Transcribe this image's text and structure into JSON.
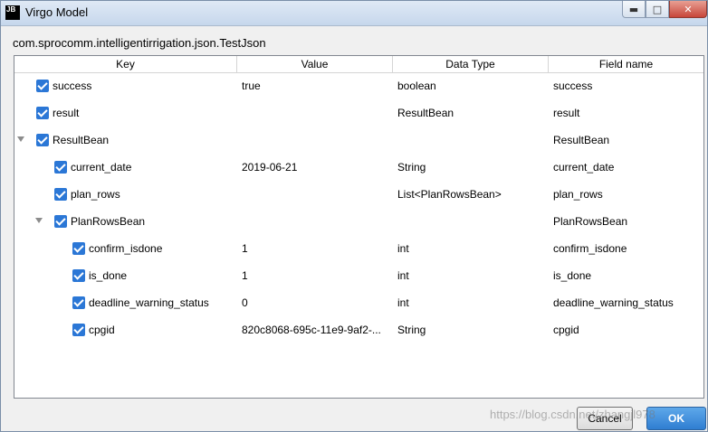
{
  "window": {
    "title": "Virgo Model",
    "icon_text_top": "JB",
    "controls": {
      "minimize_icon": "minimize-icon",
      "maximize_icon": "maximize-icon",
      "close_icon": "close-icon"
    }
  },
  "class_name": "com.sprocomm.intelligentirrigation.json.TestJson",
  "table": {
    "columns": [
      "Key",
      "Value",
      "Data Type",
      "Field name"
    ],
    "rows": [
      {
        "key": "success",
        "value": "true",
        "type": "boolean",
        "field": "success",
        "checked": true,
        "expandable": false
      },
      {
        "key": "result",
        "value": "",
        "type": "ResultBean",
        "field": "result",
        "checked": true,
        "expandable": false
      },
      {
        "key": "ResultBean",
        "value": "",
        "type": "",
        "field": "ResultBean",
        "checked": true,
        "expandable": true
      },
      {
        "key": "current_date",
        "value": "2019-06-21",
        "type": "String",
        "field": "current_date",
        "checked": true,
        "expandable": false
      },
      {
        "key": "plan_rows",
        "value": "",
        "type": "List<PlanRowsBean>",
        "field": "plan_rows",
        "checked": true,
        "expandable": false
      },
      {
        "key": "PlanRowsBean",
        "value": "",
        "type": "",
        "field": "PlanRowsBean",
        "checked": true,
        "expandable": true
      },
      {
        "key": "confirm_isdone",
        "value": "1",
        "type": "int",
        "field": "confirm_isdone",
        "checked": true,
        "expandable": false
      },
      {
        "key": "is_done",
        "value": "1",
        "type": "int",
        "field": "is_done",
        "checked": true,
        "expandable": false
      },
      {
        "key": "deadline_warning_status",
        "value": "0",
        "type": "int",
        "field": "deadline_warning_status",
        "checked": true,
        "expandable": false
      },
      {
        "key": "cpgid",
        "value": "820c8068-695c-11e9-9af2-...",
        "type": "String",
        "field": "cpgid",
        "checked": true,
        "expandable": false
      }
    ]
  },
  "buttons": {
    "cancel": "Cancel",
    "ok": "OK"
  },
  "watermark": "https://blog.csdn.net/zhangjl978",
  "colors": {
    "checkbox": "#2b77d6",
    "ok_button": "#2f7ed1"
  }
}
